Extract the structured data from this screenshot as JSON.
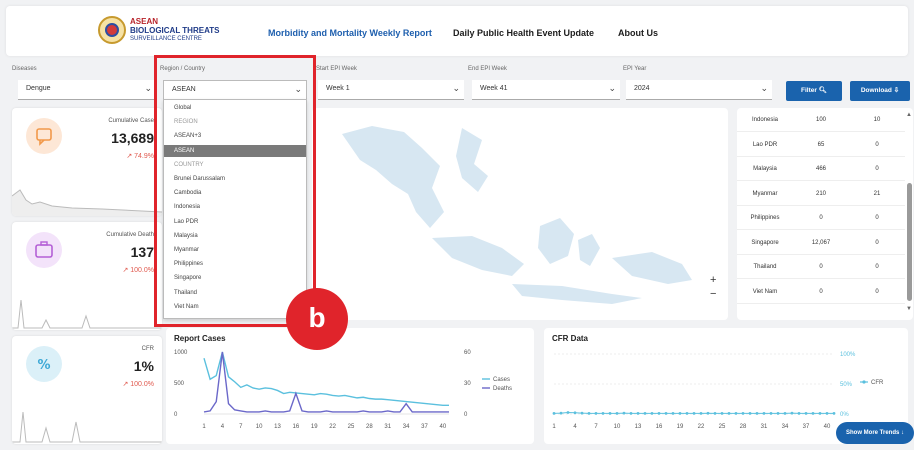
{
  "header": {
    "logo_line1": "ASEAN",
    "logo_line2": "BIOLOGICAL THREATS",
    "logo_line3": "SURVEILLANCE CENTRE",
    "nav": [
      "Morbidity and Mortality Weekly Report",
      "Daily Public Health Event Update",
      "About Us"
    ]
  },
  "filters": {
    "diseases_label": "Diseases",
    "diseases_value": "Dengue",
    "region_label": "Region / Country",
    "region_value": "ASEAN",
    "start_label": "Start EPI Week",
    "start_value": "Week 1",
    "end_label": "End EPI Week",
    "end_value": "Week 41",
    "year_label": "EPI Year",
    "year_value": "2024",
    "filter_button": "Filter",
    "download_button": "Download"
  },
  "cards": [
    {
      "label": "Cumulative Case",
      "value": "13,689",
      "change": "↗ 74.9%",
      "color": "#f2994a",
      "icon": "chat-icon"
    },
    {
      "label": "Cumulative Death",
      "value": "137",
      "change": "↗ 100.0%",
      "color": "#b45fd6",
      "icon": "briefcase-icon"
    },
    {
      "label": "CFR",
      "value": "1%",
      "change": "↗ 100.0%",
      "color": "#3fa9d6",
      "icon": "percent-icon"
    }
  ],
  "dropdown": {
    "items": [
      {
        "label": "Global",
        "kind": "option"
      },
      {
        "label": "REGION",
        "kind": "group"
      },
      {
        "label": "ASEAN+3",
        "kind": "option"
      },
      {
        "label": "ASEAN",
        "kind": "selected"
      },
      {
        "label": "COUNTRY",
        "kind": "group"
      },
      {
        "label": "Brunei Darussalam",
        "kind": "option"
      },
      {
        "label": "Cambodia",
        "kind": "option"
      },
      {
        "label": "Indonesia",
        "kind": "option"
      },
      {
        "label": "Lao PDR",
        "kind": "option"
      },
      {
        "label": "Malaysia",
        "kind": "option"
      },
      {
        "label": "Myanmar",
        "kind": "option"
      },
      {
        "label": "Philippines",
        "kind": "option"
      },
      {
        "label": "Singapore",
        "kind": "option"
      },
      {
        "label": "Thailand",
        "kind": "option"
      },
      {
        "label": "Viet Nam",
        "kind": "option"
      }
    ]
  },
  "annotation": {
    "label": "b"
  },
  "map": {
    "zoom_in": "+",
    "zoom_out": "−"
  },
  "table": {
    "rows": [
      [
        "Indonesia",
        "100",
        "10"
      ],
      [
        "Lao PDR",
        "65",
        "0"
      ],
      [
        "Malaysia",
        "466",
        "0"
      ],
      [
        "Myanmar",
        "210",
        "21"
      ],
      [
        "Philippines",
        "0",
        "0"
      ],
      [
        "Singapore",
        "12,067",
        "0"
      ],
      [
        "Thailand",
        "0",
        "0"
      ],
      [
        "Viet Nam",
        "0",
        "0"
      ]
    ]
  },
  "report_chart": {
    "title": "Report Cases",
    "legend": [
      "Cases",
      "Deaths"
    ],
    "left_ticks": [
      "1000",
      "500",
      "0"
    ],
    "right_ticks": [
      "60",
      "30",
      "0"
    ],
    "x_ticks": [
      "1",
      "4",
      "7",
      "10",
      "13",
      "16",
      "19",
      "22",
      "25",
      "28",
      "31",
      "34",
      "37",
      "40"
    ]
  },
  "cfr_chart": {
    "title": "CFR Data",
    "legend": [
      "CFR"
    ],
    "right_ticks": [
      "100%",
      "50%",
      "0%"
    ],
    "x_ticks": [
      "1",
      "4",
      "7",
      "10",
      "13",
      "16",
      "19",
      "22",
      "25",
      "28",
      "31",
      "34",
      "37",
      "40"
    ]
  },
  "more_button": "Show More Trends",
  "chart_data": [
    {
      "type": "line",
      "title": "Report Cases",
      "x": [
        1,
        2,
        3,
        4,
        5,
        6,
        7,
        8,
        9,
        10,
        11,
        12,
        13,
        14,
        15,
        16,
        17,
        18,
        19,
        20,
        21,
        22,
        23,
        24,
        25,
        26,
        27,
        28,
        29,
        30,
        31,
        32,
        33,
        34,
        35,
        36,
        37,
        38,
        39,
        40,
        41
      ],
      "series": [
        {
          "name": "Cases",
          "axis": "left",
          "values": [
            900,
            560,
            620,
            1000,
            600,
            520,
            430,
            470,
            420,
            400,
            420,
            410,
            380,
            330,
            350,
            340,
            330,
            320,
            310,
            330,
            320,
            300,
            290,
            300,
            280,
            260,
            270,
            250,
            240,
            240,
            230,
            220,
            210,
            200,
            190,
            180,
            170,
            160,
            150,
            140,
            140
          ]
        },
        {
          "name": "Deaths",
          "axis": "right",
          "values": [
            2,
            3,
            12,
            60,
            10,
            4,
            3,
            2,
            2,
            2,
            3,
            2,
            2,
            2,
            3,
            20,
            3,
            2,
            2,
            2,
            3,
            2,
            2,
            2,
            2,
            2,
            3,
            2,
            2,
            2,
            3,
            2,
            2,
            10,
            2,
            2,
            2,
            2,
            2,
            2,
            2
          ]
        }
      ],
      "ylim_left": [
        0,
        1000
      ],
      "ylim_right": [
        0,
        60
      ]
    },
    {
      "type": "line",
      "title": "CFR Data",
      "x": [
        1,
        2,
        3,
        4,
        5,
        6,
        7,
        8,
        9,
        10,
        11,
        12,
        13,
        14,
        15,
        16,
        17,
        18,
        19,
        20,
        21,
        22,
        23,
        24,
        25,
        26,
        27,
        28,
        29,
        30,
        31,
        32,
        33,
        34,
        35,
        36,
        37,
        38,
        39,
        40,
        41
      ],
      "series": [
        {
          "name": "CFR",
          "values": [
            1,
            1.5,
            2.5,
            2,
            1.5,
            1,
            1,
            1,
            1,
            1,
            1.5,
            1,
            1,
            1,
            1,
            1,
            1,
            1,
            1,
            1,
            1,
            1,
            1.2,
            1,
            1,
            1,
            1,
            1,
            1,
            1,
            1,
            1,
            1,
            1,
            1.5,
            1,
            1,
            1,
            1,
            1,
            1
          ]
        }
      ],
      "ylim": [
        0,
        100
      ]
    }
  ]
}
